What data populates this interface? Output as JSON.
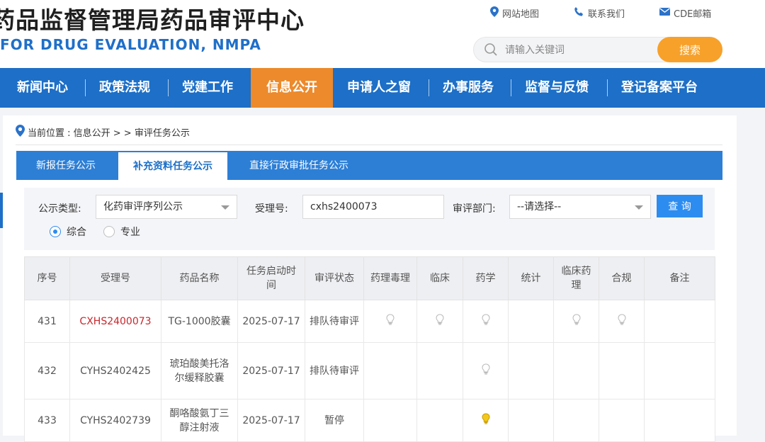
{
  "header": {
    "logo_cn": "药品监督管理局药品审评中心",
    "logo_en": "FOR DRUG EVALUATION, NMPA",
    "links": [
      {
        "label": "网站地图",
        "icon": "location-pin-icon"
      },
      {
        "label": "联系我们",
        "icon": "phone-icon"
      },
      {
        "label": "CDE邮箱",
        "icon": "mail-icon"
      }
    ],
    "search": {
      "placeholder": "请输入关键词",
      "button": "搜索"
    }
  },
  "nav": {
    "items": [
      "新闻中心",
      "政策法规",
      "党建工作",
      "信息公开",
      "申请人之窗",
      "办事服务",
      "监督与反馈",
      "登记备案平台"
    ],
    "active": "信息公开"
  },
  "breadcrumb": {
    "text": "当前位置 : 信息公开 > > 审评任务公示"
  },
  "tabs": {
    "items": [
      "新报任务公示",
      "补充资料任务公示",
      "直接行政审批任务公示"
    ],
    "active": "补充资料任务公示"
  },
  "filter": {
    "type_label": "公示类型:",
    "type_value": "化药审评序列公示",
    "accept_label": "受理号:",
    "accept_value": "cxhs2400073",
    "dept_label": "审评部门:",
    "dept_value": "--请选择--",
    "query_button": "查 询",
    "radio_all": "综合",
    "radio_pro": "专业"
  },
  "table": {
    "headers": [
      "序号",
      "受理号",
      "药品名称",
      "任务启动时间",
      "审评状态",
      "药理毒理",
      "临床",
      "药学",
      "统计",
      "临床药理",
      "合规",
      "备注"
    ],
    "rows": [
      {
        "no": "431",
        "accept": "CXHS2400073",
        "name": "TG-1000胶囊",
        "date": "2025-07-17",
        "status": "排队待审评",
        "marks": {
          "pharm_tox": "grey",
          "clinical": "grey",
          "pharmacy": "grey",
          "stat": "",
          "clin_pharm": "grey",
          "compliance": "grey"
        },
        "remark": ""
      },
      {
        "no": "432",
        "accept": "CYHS2402425",
        "name": "琥珀酸美托洛尔缓释胶囊",
        "date": "2025-07-17",
        "status": "排队待审评",
        "marks": {
          "pharm_tox": "",
          "clinical": "",
          "pharmacy": "grey",
          "stat": "",
          "clin_pharm": "",
          "compliance": ""
        },
        "remark": ""
      },
      {
        "no": "433",
        "accept": "CYHS2402739",
        "name": "酮咯酸氨丁三醇注射液",
        "date": "2025-07-17",
        "status": "暂停",
        "marks": {
          "pharm_tox": "",
          "clinical": "",
          "pharmacy": "yellow",
          "stat": "",
          "clin_pharm": "",
          "compliance": ""
        },
        "remark": ""
      }
    ]
  },
  "colors": {
    "nav_blue": "#1d6fc7",
    "nav_active": "#ec8a2c",
    "search_btn": "#f7a12a",
    "link_red": "#c8262b",
    "bulb_yellow": "#f2c81c",
    "bulb_grey": "#b8b8b8"
  }
}
